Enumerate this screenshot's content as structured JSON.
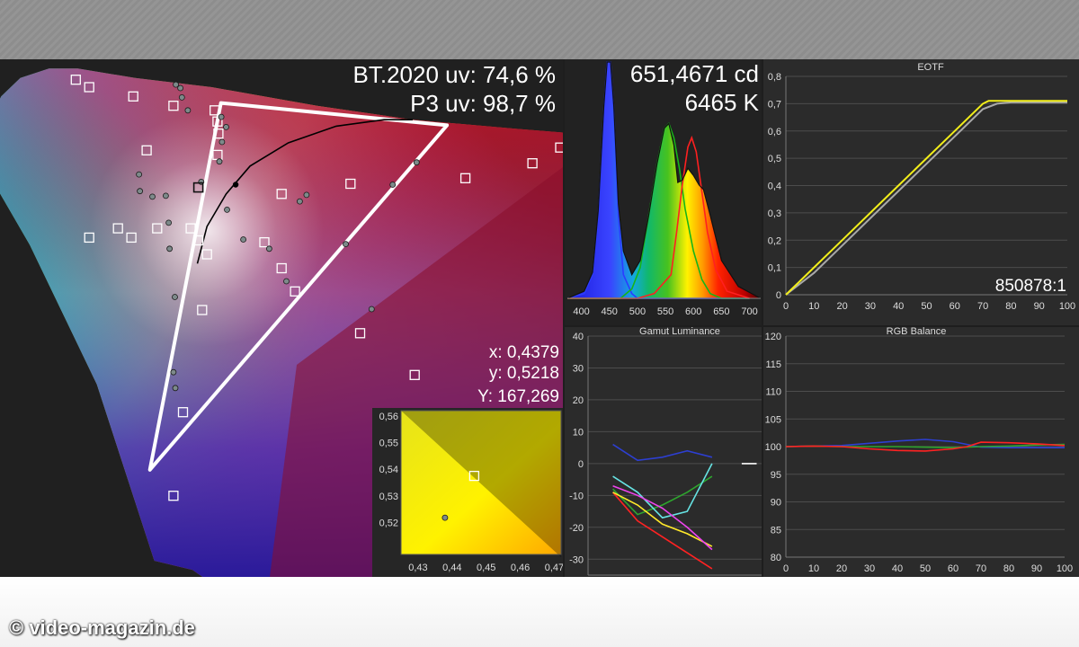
{
  "credit": "© video-magazin.de",
  "chart_data": [
    {
      "type": "scatter",
      "title": "",
      "readouts": [
        "BT.2020 uv: 74,6 %",
        "P3 uv: 98,7 %"
      ],
      "measurement": {
        "x": "x: 0,4379",
        "y": "y: 0,5218",
        "Y": "Y: 167,269"
      },
      "triangle_uv": [
        [
          0.2496,
          0.553
        ],
        [
          0.4858,
          0.529
        ],
        [
          0.1754,
          0.1579
        ]
      ],
      "targets_uv": [
        [
          0.098,
          0.578
        ],
        [
          0.112,
          0.57
        ],
        [
          0.158,
          0.56
        ],
        [
          0.2,
          0.55
        ],
        [
          0.243,
          0.545
        ],
        [
          0.246,
          0.533
        ],
        [
          0.247,
          0.52
        ],
        [
          0.246,
          0.497
        ],
        [
          0.172,
          0.502
        ],
        [
          0.604,
          0.505
        ],
        [
          0.575,
          0.488
        ],
        [
          0.505,
          0.472
        ],
        [
          0.385,
          0.466
        ],
        [
          0.313,
          0.455
        ],
        [
          0.142,
          0.418
        ],
        [
          0.183,
          0.418
        ],
        [
          0.218,
          0.418
        ],
        [
          0.112,
          0.408
        ],
        [
          0.156,
          0.408
        ],
        [
          0.226,
          0.405
        ],
        [
          0.295,
          0.403
        ],
        [
          0.235,
          0.39
        ],
        [
          0.313,
          0.375
        ],
        [
          0.327,
          0.35
        ],
        [
          0.23,
          0.33
        ],
        [
          0.395,
          0.305
        ],
        [
          0.452,
          0.26
        ],
        [
          0.21,
          0.22
        ],
        [
          0.2,
          0.13
        ],
        [
          0.18,
          0.005
        ]
      ],
      "measured_uv": [
        [
          0.2025,
          0.5728
        ],
        [
          0.2072,
          0.569
        ],
        [
          0.2088,
          0.559
        ],
        [
          0.215,
          0.545
        ],
        [
          0.25,
          0.538
        ],
        [
          0.255,
          0.527
        ],
        [
          0.2507,
          0.511
        ],
        [
          0.248,
          0.49
        ],
        [
          0.229,
          0.468
        ],
        [
          0.164,
          0.476
        ],
        [
          0.165,
          0.458
        ],
        [
          0.178,
          0.452
        ],
        [
          0.192,
          0.453
        ],
        [
          0.195,
          0.424
        ],
        [
          0.196,
          0.396
        ],
        [
          0.2015,
          0.344
        ],
        [
          0.202,
          0.246
        ],
        [
          0.2,
          0.263
        ],
        [
          0.256,
          0.438
        ],
        [
          0.273,
          0.406
        ],
        [
          0.332,
          0.447
        ],
        [
          0.339,
          0.454
        ],
        [
          0.429,
          0.465
        ],
        [
          0.454,
          0.489
        ],
        [
          0.318,
          0.361
        ],
        [
          0.3,
          0.396
        ],
        [
          0.407,
          0.331
        ],
        [
          0.38,
          0.401
        ]
      ],
      "white_point_uv": [
        0.265,
        0.465
      ],
      "target_marker_uv": [
        0.226,
        0.462
      ],
      "planckian_uv": [
        [
          0.225,
          0.38
        ],
        [
          0.235,
          0.42
        ],
        [
          0.255,
          0.455
        ],
        [
          0.28,
          0.485
        ],
        [
          0.32,
          0.51
        ],
        [
          0.37,
          0.528
        ],
        [
          0.42,
          0.535
        ],
        [
          0.45,
          0.535
        ]
      ]
    },
    {
      "type": "scatter",
      "title": "",
      "xlim": [
        0.425,
        0.472
      ],
      "ylim": [
        0.508,
        0.562
      ],
      "x_ticks": [
        0.43,
        0.44,
        0.45,
        0.46,
        0.47
      ],
      "y_ticks": [
        0.52,
        0.53,
        0.54,
        0.55,
        0.56
      ],
      "x_tick_labels": [
        "0,43",
        "0,44",
        "0,45",
        "0,46",
        "0,47"
      ],
      "y_tick_labels": [
        "0,52",
        "0,53",
        "0,54",
        "0,55",
        "0,56"
      ],
      "target": [
        0.4465,
        0.5375
      ],
      "measured": [
        0.4379,
        0.5218
      ],
      "gamut_edge": [
        [
          0.425,
          0.562
        ],
        [
          0.472,
          0.507
        ]
      ]
    },
    {
      "type": "line",
      "title": "",
      "readouts": [
        "651,4671 cd",
        "6465 K"
      ],
      "xlim": [
        375,
        720
      ],
      "ylim": [
        0,
        1
      ],
      "x_ticks": [
        400,
        450,
        500,
        550,
        600,
        650,
        700
      ],
      "series": [
        {
          "color": "#2c3cff",
          "x": [
            375,
            405,
            420,
            430,
            440,
            446,
            452,
            458,
            466,
            475,
            490,
            500,
            520,
            545,
            570,
            590,
            610,
            630,
            660,
            700
          ],
          "y": [
            0.0,
            0.02,
            0.1,
            0.35,
            0.8,
            1.0,
            1.0,
            0.8,
            0.35,
            0.1,
            0.02,
            0.0,
            0.0,
            0.0,
            0.0,
            0.0,
            0.0,
            0.0,
            0.0,
            0.0
          ]
        },
        {
          "color": "#18b418",
          "x": [
            375,
            470,
            490,
            505,
            520,
            535,
            548,
            556,
            565,
            575,
            585,
            600,
            615,
            630,
            650,
            700
          ],
          "y": [
            0.0,
            0.0,
            0.04,
            0.13,
            0.35,
            0.57,
            0.72,
            0.74,
            0.68,
            0.55,
            0.38,
            0.2,
            0.08,
            0.02,
            0.0,
            0.0
          ]
        },
        {
          "color": "#ff2020",
          "x": [
            375,
            500,
            530,
            560,
            570,
            580,
            590,
            597,
            605,
            615,
            625,
            640,
            660,
            700
          ],
          "y": [
            0.0,
            0.0,
            0.02,
            0.1,
            0.28,
            0.48,
            0.64,
            0.68,
            0.62,
            0.45,
            0.28,
            0.12,
            0.03,
            0.0
          ]
        },
        {
          "color": "#111111",
          "x": [
            375,
            405,
            420,
            430,
            440,
            446,
            452,
            458,
            466,
            475,
            490,
            505,
            520,
            535,
            548,
            556,
            565,
            572,
            580,
            590,
            600,
            610,
            618,
            630,
            650,
            680,
            720
          ],
          "y": [
            0.0,
            0.03,
            0.11,
            0.37,
            0.81,
            1.0,
            1.0,
            0.81,
            0.4,
            0.2,
            0.1,
            0.16,
            0.35,
            0.57,
            0.72,
            0.74,
            0.65,
            0.49,
            0.5,
            0.55,
            0.52,
            0.48,
            0.46,
            0.35,
            0.16,
            0.05,
            0.0
          ]
        }
      ]
    },
    {
      "type": "line",
      "title": "EOTF",
      "readout": "850878:1",
      "xlim": [
        0,
        100
      ],
      "ylim": [
        0,
        0.8
      ],
      "x_ticks": [
        0,
        10,
        20,
        30,
        40,
        50,
        60,
        70,
        80,
        90,
        100
      ],
      "y_ticks": [
        0,
        0.1,
        0.2,
        0.3,
        0.4,
        0.5,
        0.6,
        0.7,
        0.8
      ],
      "x_tick_labels": [
        "0",
        "10",
        "20",
        "30",
        "40",
        "50",
        "60",
        "70",
        "80",
        "90",
        "100"
      ],
      "y_tick_labels": [
        "0",
        "0,1",
        "0,2",
        "0,3",
        "0,4",
        "0,5",
        "0,6",
        "0,7",
        "0,8"
      ],
      "series": [
        {
          "color": "#a9a9a9",
          "x": [
            0,
            10,
            20,
            30,
            40,
            50,
            60,
            70,
            75,
            80,
            100
          ],
          "y": [
            0.0,
            0.08,
            0.18,
            0.28,
            0.38,
            0.48,
            0.58,
            0.68,
            0.7,
            0.705,
            0.705
          ]
        },
        {
          "color": "#f2ee1a",
          "x": [
            0,
            10,
            20,
            30,
            40,
            50,
            60,
            70,
            72,
            80,
            100
          ],
          "y": [
            0.0,
            0.1,
            0.2,
            0.3,
            0.4,
            0.5,
            0.6,
            0.7,
            0.71,
            0.71,
            0.71
          ]
        }
      ]
    },
    {
      "type": "line",
      "title": "Gamut Luminance",
      "xlim": [
        0,
        7
      ],
      "ylim": [
        -35,
        40
      ],
      "y_ticks": [
        -30,
        -20,
        -10,
        0,
        10,
        20,
        30,
        40
      ],
      "y_tick_labels": [
        "-30",
        "-20",
        "-10",
        "0",
        "10",
        "20",
        "30",
        "40"
      ],
      "series": [
        {
          "color": "#2d3fd1",
          "x": [
            1,
            2,
            3,
            4,
            5
          ],
          "y": [
            6,
            1,
            2,
            4,
            2
          ]
        },
        {
          "color": "#2ea52e",
          "x": [
            1,
            2,
            3,
            4,
            5
          ],
          "y": [
            -8,
            -16,
            -13,
            -9,
            -4
          ]
        },
        {
          "color": "#ff2222",
          "x": [
            1,
            2,
            3,
            4,
            5
          ],
          "y": [
            -9,
            -18,
            -23,
            -28,
            -33
          ]
        },
        {
          "color": "#ffe92a",
          "x": [
            1,
            2,
            3,
            4,
            5
          ],
          "y": [
            -9,
            -13,
            -19,
            -22,
            -26
          ]
        },
        {
          "color": "#66e3e3",
          "x": [
            1,
            2,
            3,
            4,
            5
          ],
          "y": [
            -4,
            -9,
            -17,
            -15,
            0
          ]
        },
        {
          "color": "#ee44ee",
          "x": [
            1,
            2,
            3,
            4,
            5
          ],
          "y": [
            -7,
            -10,
            -14,
            -20,
            -27
          ]
        },
        {
          "color": "#ffffff",
          "x": [
            6.2,
            6.8
          ],
          "y": [
            0,
            0
          ]
        }
      ]
    },
    {
      "type": "line",
      "title": "RGB Balance",
      "xlim": [
        0,
        100
      ],
      "ylim": [
        80,
        120
      ],
      "x_ticks": [
        0,
        10,
        20,
        30,
        40,
        50,
        60,
        70,
        80,
        90,
        100
      ],
      "y_ticks": [
        80,
        85,
        90,
        95,
        100,
        105,
        110,
        115,
        120
      ],
      "x_tick_labels": [
        "0",
        "10",
        "20",
        "30",
        "40",
        "50",
        "60",
        "70",
        "80",
        "90",
        "100"
      ],
      "y_tick_labels": [
        "80",
        "85",
        "90",
        "95",
        "100",
        "105",
        "110",
        "115",
        "120"
      ],
      "series": [
        {
          "color": "#2d3fd1",
          "x": [
            0,
            10,
            20,
            30,
            40,
            50,
            60,
            70,
            80,
            90,
            100
          ],
          "y": [
            100.0,
            100.1,
            100.2,
            100.6,
            101.0,
            101.3,
            100.9,
            99.9,
            99.8,
            99.8,
            99.8
          ]
        },
        {
          "color": "#2ea52e",
          "x": [
            0,
            10,
            20,
            30,
            40,
            50,
            60,
            70,
            80,
            90,
            100
          ],
          "y": [
            100.0,
            100.1,
            100.0,
            100.0,
            100.0,
            99.9,
            99.8,
            100.0,
            100.1,
            100.3,
            100.4
          ]
        },
        {
          "color": "#ff2222",
          "x": [
            0,
            10,
            20,
            30,
            40,
            50,
            60,
            65,
            70,
            80,
            90,
            100
          ],
          "y": [
            100.0,
            100.1,
            100.0,
            99.6,
            99.3,
            99.2,
            99.6,
            100.0,
            100.8,
            100.7,
            100.5,
            100.2
          ]
        }
      ]
    }
  ]
}
